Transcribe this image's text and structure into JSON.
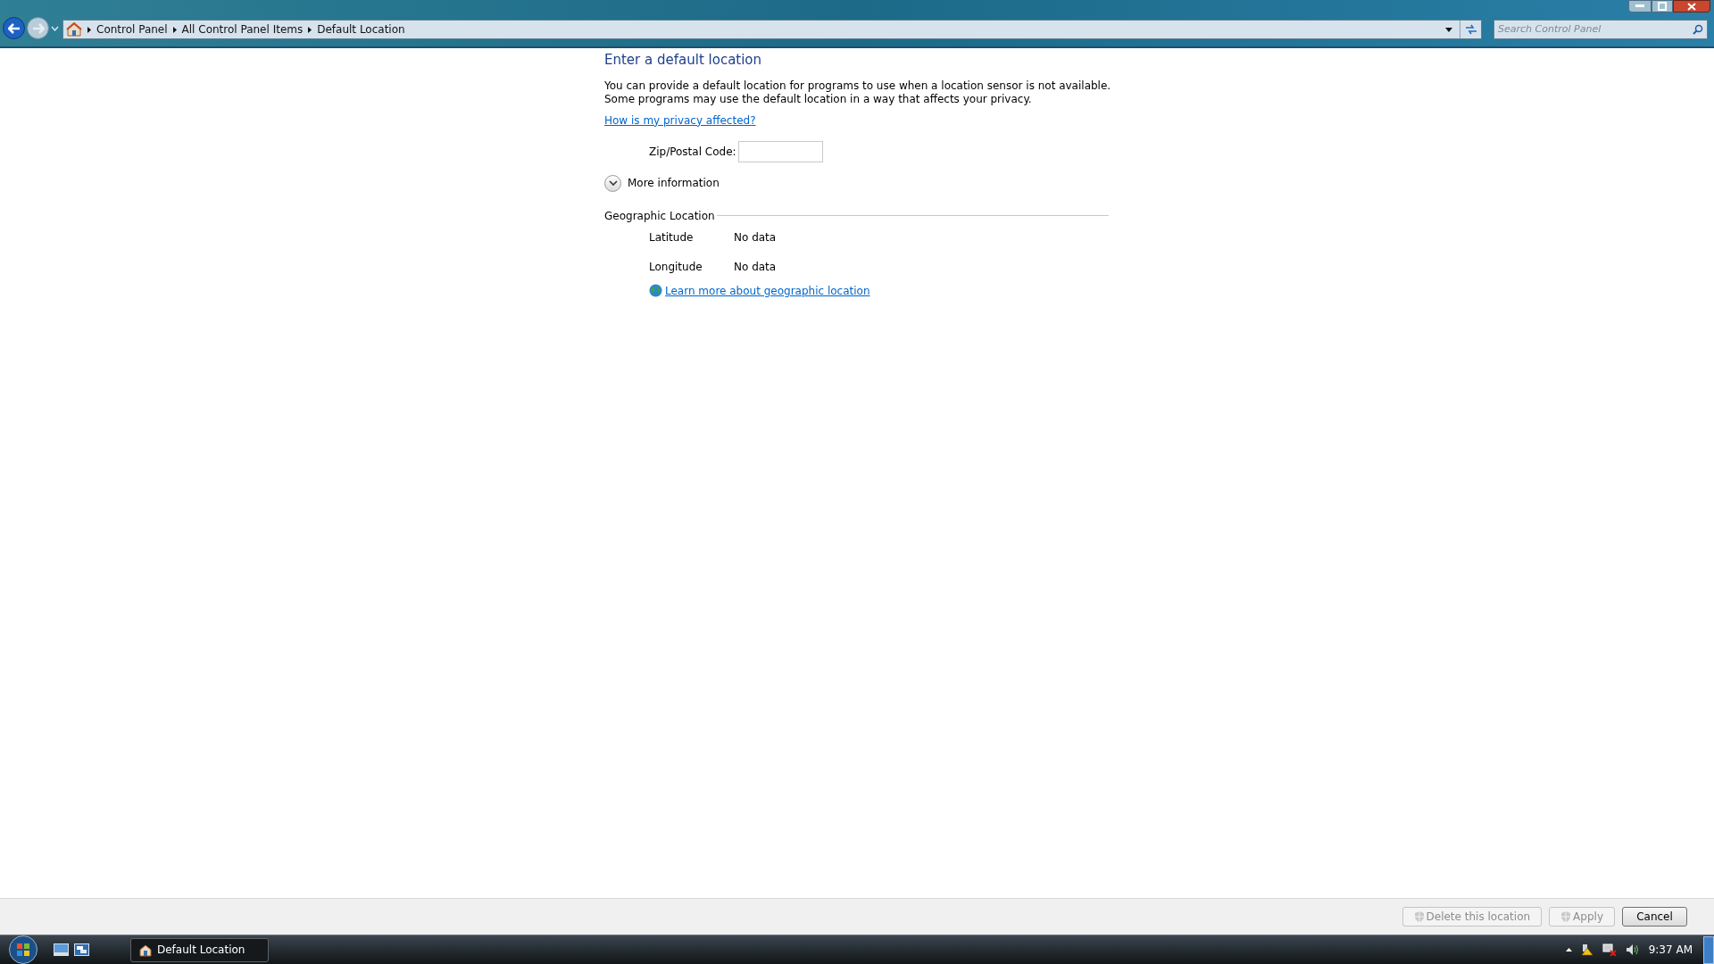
{
  "breadcrumb": [
    "Control Panel",
    "All Control Panel Items",
    "Default Location"
  ],
  "search": {
    "placeholder": "Search Control Panel"
  },
  "heading": "Enter a default location",
  "description": [
    "You can provide a default location for programs to use when a location sensor is not available.",
    "Some programs may use the default location in a way that affects your privacy."
  ],
  "privacy_link": "How is my privacy affected?",
  "zip_field": {
    "label": "Zip/Postal Code:"
  },
  "more_information": {
    "label": "More information",
    "expanded": false
  },
  "geographic_location": {
    "title": "Geographic Location",
    "rows": [
      {
        "label": "Latitude",
        "value": "No data"
      },
      {
        "label": "Longitude",
        "value": "No data"
      }
    ],
    "link": "Learn more about geographic location"
  },
  "buttons": [
    {
      "label": "Delete this location",
      "shield": true,
      "disabled": true
    },
    {
      "label": "Apply",
      "shield": true,
      "disabled": true
    },
    {
      "label": "Cancel",
      "shield": false,
      "disabled": false
    }
  ],
  "taskbar": {
    "window": "Default Location",
    "clock": "9:37 AM"
  }
}
